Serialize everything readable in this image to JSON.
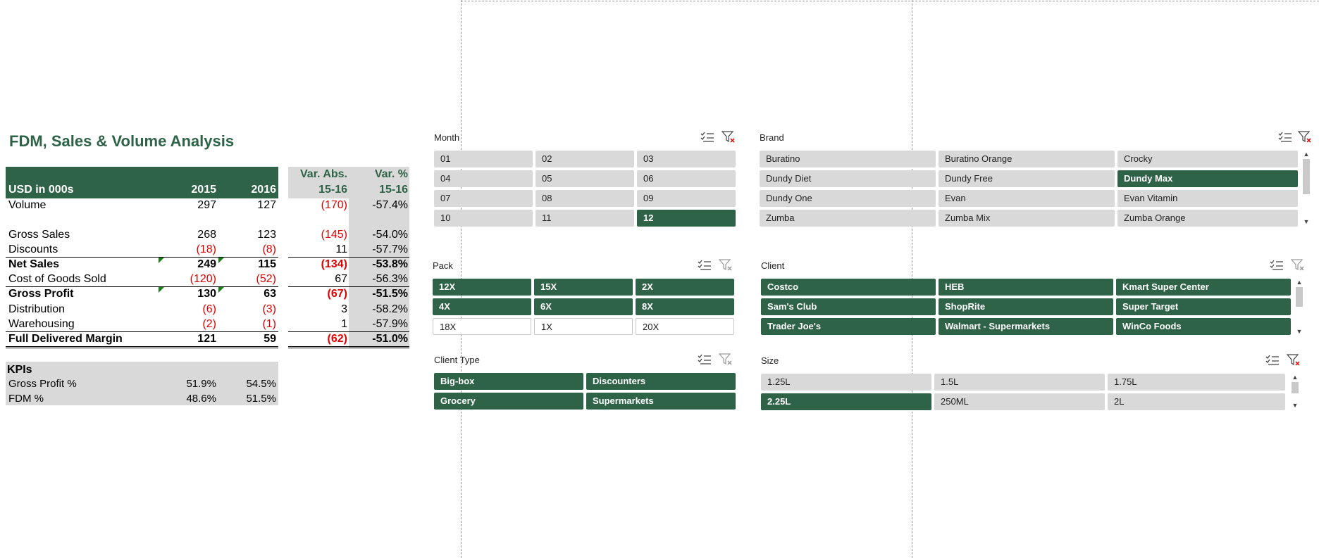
{
  "report": {
    "title": "FDM, Sales & Volume Analysis",
    "header": {
      "unit_label": "USD in 000s",
      "col_2015": "2015",
      "col_2016": "2016",
      "var_abs_line1": "Var. Abs.",
      "var_abs_line2": "15-16",
      "var_pct_line1": "Var. %",
      "var_pct_line2": "15-16"
    },
    "rows": [
      {
        "label": "Volume",
        "v2015": "297",
        "v2016": "127",
        "var_abs": "(170)",
        "var_pct": "-57.4%"
      },
      {
        "label": "Gross Sales",
        "v2015": "268",
        "v2016": "123",
        "var_abs": "(145)",
        "var_pct": "-54.0%"
      },
      {
        "label": "Discounts",
        "v2015": "(18)",
        "v2016": "(8)",
        "var_abs": "11",
        "var_pct": "-57.7%"
      },
      {
        "label": "Net Sales",
        "v2015": "249",
        "v2016": "115",
        "var_abs": "(134)",
        "var_pct": "-53.8%"
      },
      {
        "label": "Cost of Goods Sold",
        "v2015": "(120)",
        "v2016": "(52)",
        "var_abs": "67",
        "var_pct": "-56.3%"
      },
      {
        "label": "Gross Profit",
        "v2015": "130",
        "v2016": "63",
        "var_abs": "(67)",
        "var_pct": "-51.5%"
      },
      {
        "label": "Distribution",
        "v2015": "(6)",
        "v2016": "(3)",
        "var_abs": "3",
        "var_pct": "-58.2%"
      },
      {
        "label": "Warehousing",
        "v2015": "(2)",
        "v2016": "(1)",
        "var_abs": "1",
        "var_pct": "-57.9%"
      },
      {
        "label": "Full Delivered Margin",
        "v2015": "121",
        "v2016": "59",
        "var_abs": "(62)",
        "var_pct": "-51.0%"
      }
    ],
    "kpis": {
      "title": "KPIs",
      "rows": [
        {
          "label": "Gross Profit %",
          "v2015": "51.9%",
          "v2016": "54.5%"
        },
        {
          "label": "FDM %",
          "v2015": "48.6%",
          "v2016": "51.5%"
        }
      ]
    }
  },
  "slicers": {
    "month": {
      "title": "Month",
      "items": [
        "01",
        "02",
        "03",
        "04",
        "05",
        "06",
        "07",
        "08",
        "09",
        "10",
        "11",
        "12"
      ]
    },
    "brand": {
      "title": "Brand",
      "items": [
        "Buratino",
        "Buratino Orange",
        "Crocky",
        "Dundy Diet",
        "Dundy Free",
        "Dundy Max",
        "Dundy One",
        "Evan",
        "Evan Vitamin",
        "Zumba",
        "Zumba Mix",
        "Zumba Orange"
      ]
    },
    "pack": {
      "title": "Pack",
      "items": [
        "12X",
        "15X",
        "2X",
        "4X",
        "6X",
        "8X",
        "18X",
        "1X",
        "20X"
      ]
    },
    "client": {
      "title": "Client",
      "items": [
        "Costco",
        "HEB",
        "Kmart Super Center",
        "Sam's Club",
        "ShopRite",
        "Super Target",
        "Trader Joe's",
        "Walmart - Supermarkets",
        "WinCo Foods"
      ]
    },
    "client_type": {
      "title": "Client Type",
      "items": [
        "Big-box",
        "Discounters",
        "Grocery",
        "Supermarkets"
      ]
    },
    "size": {
      "title": "Size",
      "items": [
        "1.25L",
        "1.5L",
        "1.75L",
        "2.25L",
        "250ML",
        "2L"
      ]
    }
  },
  "colors": {
    "accent_green": "#2e6347",
    "negative_red": "#e00000",
    "slicer_item_grey": "#d9d9d9"
  },
  "icons": {
    "multi_select": "multi-select-icon",
    "clear_filter": "clear-filter-icon"
  }
}
